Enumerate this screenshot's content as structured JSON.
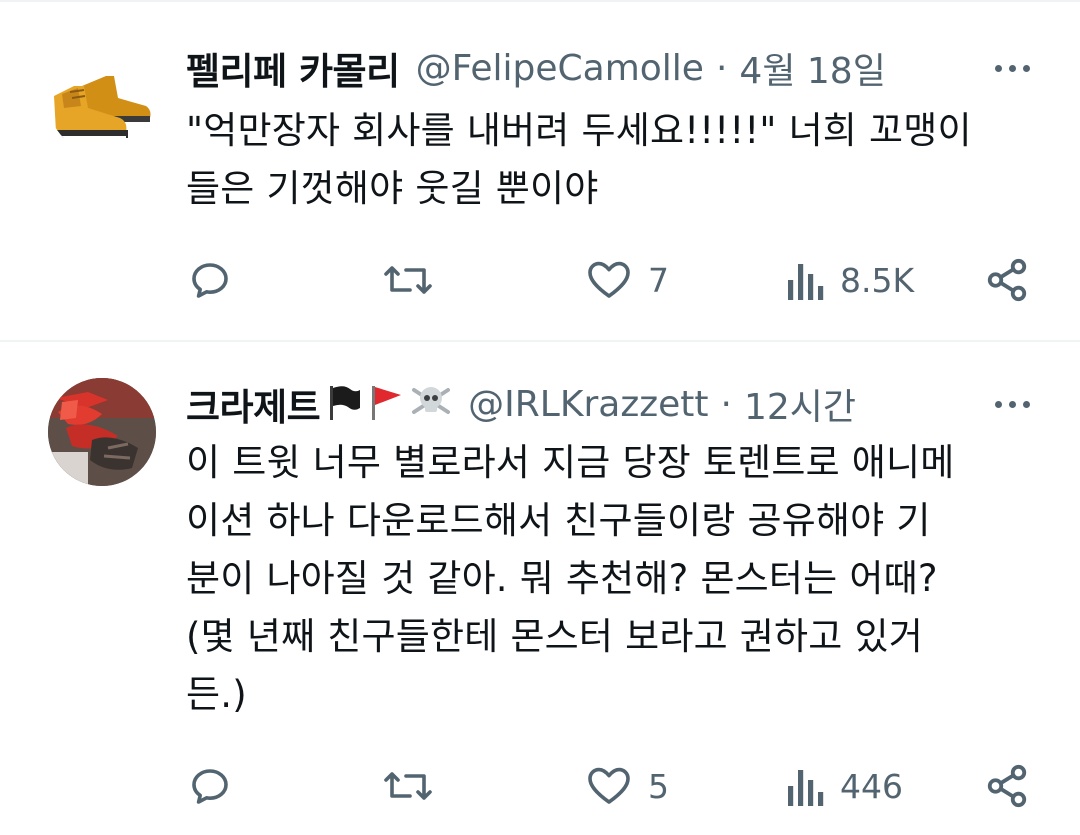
{
  "tweets": [
    {
      "display_name": "펠리페 카몰리",
      "handle": "@FelipeCamolle",
      "separator": "·",
      "timestamp": "4월 18일",
      "text": "\"억만장자 회사를 내버려 두세요!!!!!\" 너희 꼬맹이\n들은 기껏해야 웃길 뿐이야",
      "stats": {
        "replies": "",
        "retweets": "",
        "likes": "7",
        "views": "8.5K"
      },
      "avatar_icon": "yellow-boots-avatar"
    },
    {
      "display_name": "크라제트",
      "name_emojis": [
        "black-flag-icon",
        "red-flag-icon",
        "skull-crossbones-icon"
      ],
      "handle": "@IRLKrazzett",
      "separator": "·",
      "timestamp": "12시간",
      "text": "이 트윗 너무 별로라서 지금 당장 토렌트로 애니메\n이션 하나 다운로드해서 친구들이랑 공유해야 기\n분이 나아질 것 같아. 뭐 추천해? 몬스터는 어때?\n(몇 년째 친구들한테 몬스터 보라고 권하고 있거\n든.)",
      "stats": {
        "replies": "",
        "retweets": "",
        "likes": "5",
        "views": "446"
      },
      "avatar_icon": "red-crab-avatar"
    }
  ],
  "colors": {
    "text_primary": "#0f1419",
    "text_secondary": "#536471",
    "divider": "#eff3f4",
    "boot_yellow": "#e3a11e",
    "flag_red": "#e0282e"
  }
}
